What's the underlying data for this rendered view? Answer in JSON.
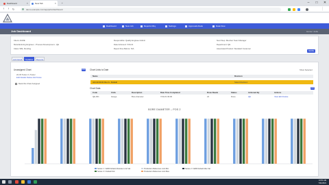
{
  "browser": {
    "tabs": [
      {
        "title": "Dashboard",
        "icon_color": "#e04a3f",
        "active": false
      },
      {
        "title": "New Tab",
        "icon_color": "#4a7fe0",
        "active": true
      },
      {
        "title": "",
        "icon_color": "#9aa0a6",
        "active": false
      }
    ],
    "url": "demo.example.com/app/jobs/dashboard",
    "controls": {
      "minimize": "–",
      "maximize": "□",
      "close": "✕"
    }
  },
  "app": {
    "nav": [
      "Dashboard",
      "New Job",
      "Reports Dbq",
      "Settings",
      "Approvals Desk",
      "Data Flow"
    ],
    "page_title": "Job Dashboard",
    "breadcrumb": "Home / Jobs"
  },
  "info": {
    "fields": [
      "Client: ACME",
      "Manufacturing Engineer - Process Development - QE",
      "Class: 999, Pending",
      "Responsible: Quality Engineer Admin",
      "Date Actioned: 7/21/21",
      "Report Due Before: N/A",
      "Next Step: Member Team Manager",
      "Department: QE",
      "Associated Product: Standard Customer"
    ],
    "save_label": "SAVE"
  },
  "page_tabs": [
    "Job Detail",
    "Updates",
    "Reports"
  ],
  "unassigned": {
    "title": "Unassigned Chart",
    "add_label": "ADD",
    "entries": [
      "22-03 Tester 2 | Tester",
      "Edit Details  Delete  Add Notes"
    ],
    "checkbox_label": "Mark this Chart Assigned"
  },
  "right": {
    "title": "Chart Links to Date",
    "show_label": "Show Selected",
    "cols": [
      "Name",
      "Revision"
    ],
    "hl_row": [
      "Job 22-03-01 Rev A - Default",
      "Select Revision"
    ],
    "sub_title": "Chart Data",
    "add_label": "ADD",
    "cols2": [
      "Code",
      "Units",
      "Description",
      "Date Time Completed",
      "Done Reads",
      "Status",
      "Actioned By",
      "Actions"
    ],
    "row": [
      "QE-001",
      "Gauge",
      "Bore diameter",
      "7/21/21 09:00",
      "24",
      "Done",
      "QE",
      "View  Edit  Delete"
    ]
  },
  "chart_data": {
    "type": "bar",
    "title": "BORE DIAMETER – POS 2",
    "categories": [
      "1",
      "2",
      "3",
      "4",
      "5",
      "6",
      "7",
      "8",
      "9",
      "10"
    ],
    "series": [
      {
        "name": "Series 1 = ERR Default Absolute Limit Val",
        "color": "#6d9ee0",
        "values": [
          14,
          40,
          40,
          40,
          40,
          40,
          40,
          40,
          40,
          40
        ]
      },
      {
        "name": "Production Reference Limit Min",
        "color": "#cfd6dd",
        "values": [
          30,
          40,
          40,
          40,
          40,
          40,
          40,
          40,
          40,
          40
        ]
      },
      {
        "name": "Series 2 = ERR Default Max Val",
        "color": "#2a3442",
        "values": [
          40,
          40,
          40,
          40,
          40,
          40,
          40,
          40,
          40,
          40
        ]
      },
      {
        "name": "Series 3 = Default Std",
        "color": "#3c7a3e",
        "values": [
          40,
          40,
          40,
          40,
          40,
          40,
          40,
          40,
          40,
          40
        ]
      },
      {
        "name": "Production Reference Limit Max",
        "color": "#f0a064",
        "values": [
          40,
          40,
          40,
          40,
          40,
          40,
          40,
          40,
          40,
          40
        ]
      }
    ],
    "ylim": [
      0,
      45
    ],
    "legend_position": "bottom"
  },
  "taskbar": {
    "time": "10:51 AM",
    "date": "7/21/2021"
  }
}
